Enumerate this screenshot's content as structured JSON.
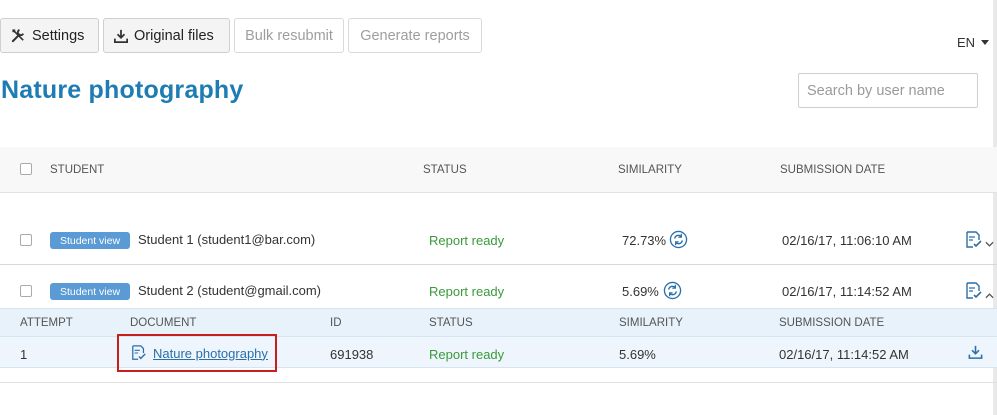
{
  "toolbar": {
    "settings_label": "Settings",
    "original_files_label": "Original files",
    "bulk_resubmit_label": "Bulk resubmit",
    "generate_reports_label": "Generate reports"
  },
  "language": "EN",
  "page_title": "Nature photography",
  "search": {
    "placeholder": "Search by user name"
  },
  "table": {
    "headers": {
      "student": "STUDENT",
      "status": "STATUS",
      "similarity": "SIMILARITY",
      "submission_date": "SUBMISSION DATE"
    },
    "rows": [
      {
        "badge": "Student view",
        "student": "Student 1 (student1@bar.com)",
        "status": "Report ready",
        "similarity": "72.73%",
        "date": "02/16/17, 11:06:10 AM"
      },
      {
        "badge": "Student view",
        "student": "Student 2 (student@gmail.com)",
        "status": "Report ready",
        "similarity": "5.69%",
        "date": "02/16/17, 11:14:52 AM"
      }
    ]
  },
  "attempts": {
    "headers": {
      "attempt": "ATTEMPT",
      "document": "DOCUMENT",
      "id": "ID",
      "status": "STATUS",
      "similarity": "SIMILARITY",
      "submission_date": "SUBMISSION DATE"
    },
    "rows": [
      {
        "attempt": "1",
        "document": "Nature photography",
        "id": "691938",
        "status": "Report ready",
        "similarity": "5.69%",
        "date": "02/16/17, 11:14:52 AM"
      }
    ]
  },
  "colors": {
    "accent": "#1e7cb4",
    "badge": "#5b9bd5",
    "status_ready": "#3a9a3a",
    "highlight": "#c81e1e"
  }
}
